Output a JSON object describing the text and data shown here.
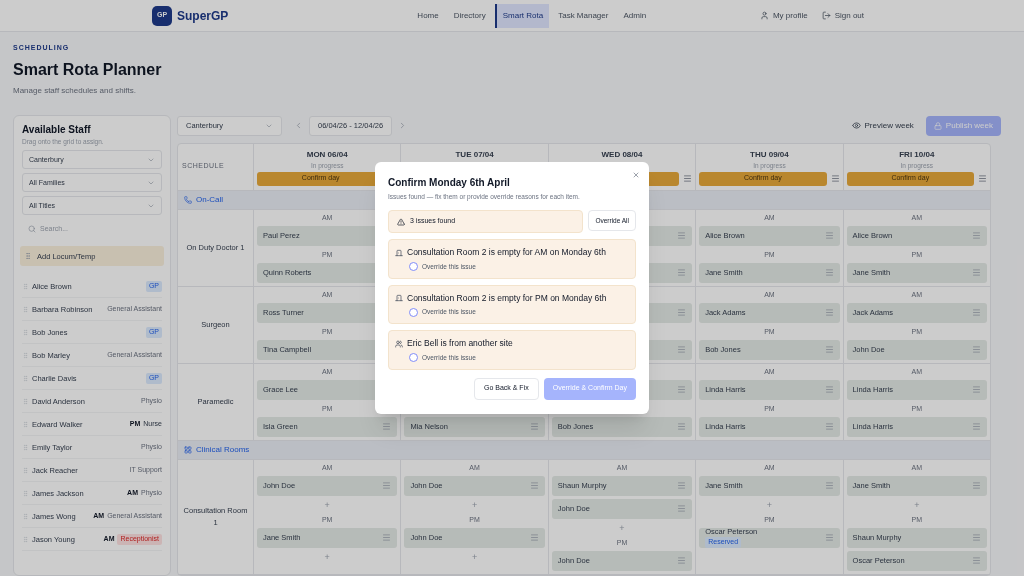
{
  "nav": {
    "logo": "GP",
    "brand": "SuperGP",
    "links": [
      {
        "label": "Home",
        "selected": false
      },
      {
        "label": "Directory",
        "selected": false
      },
      {
        "label": "Smart Rota",
        "selected": true
      },
      {
        "label": "Task Manager",
        "selected": false
      },
      {
        "label": "Admin",
        "selected": false
      }
    ],
    "profile": "My profile",
    "sign_out": "Sign out"
  },
  "header": {
    "eyebrow": "SCHEDULING",
    "title": "Smart Rota Planner",
    "subtitle": "Manage staff schedules and shifts."
  },
  "sidebar": {
    "title": "Available Staff",
    "hint": "Drag onto the grid to assign.",
    "filters": [
      "Canterbury",
      "All Families",
      "All Titles"
    ],
    "search": {
      "placeholder": "Search..."
    },
    "add_button": "Add Locum/Temp",
    "staff": [
      {
        "name": "Alice Brown",
        "tags": [
          {
            "text": "GP",
            "kind": "clinician"
          }
        ]
      },
      {
        "name": "Barbara Robinson",
        "tags": [
          {
            "text": "General Assistant",
            "kind": "role"
          }
        ]
      },
      {
        "name": "Bob Jones",
        "tags": [
          {
            "text": "GP",
            "kind": "clinician"
          }
        ]
      },
      {
        "name": "Bob Marley",
        "tags": [
          {
            "text": "General Assistant",
            "kind": "role"
          }
        ]
      },
      {
        "name": "Charlie Davis",
        "tags": [
          {
            "text": "GP",
            "kind": "clinician"
          }
        ]
      },
      {
        "name": "David Anderson",
        "tags": [
          {
            "text": "Physio",
            "kind": "role"
          }
        ]
      },
      {
        "name": "Edward Walker",
        "tags": [
          {
            "text": "PM",
            "kind": "shift"
          },
          {
            "text": "Nurse",
            "kind": "nurse"
          }
        ]
      },
      {
        "name": "Emily Taylor",
        "tags": [
          {
            "text": "Physio",
            "kind": "role"
          }
        ]
      },
      {
        "name": "Jack Reacher",
        "tags": [
          {
            "text": "IT Support",
            "kind": "role"
          }
        ]
      },
      {
        "name": "James Jackson",
        "tags": [
          {
            "text": "AM",
            "kind": "shift"
          },
          {
            "text": "Physio",
            "kind": "role"
          }
        ]
      },
      {
        "name": "James Wong",
        "tags": [
          {
            "text": "AM",
            "kind": "shift"
          },
          {
            "text": "General Assistant",
            "kind": "role"
          }
        ]
      },
      {
        "name": "Jason Young",
        "tags": [
          {
            "text": "AM",
            "kind": "shift"
          },
          {
            "text": "Receptionist",
            "kind": "alert"
          }
        ]
      }
    ]
  },
  "toolbar": {
    "location": "Canterbury",
    "date_range": "06/04/26 - 12/04/26",
    "preview": "Preview week",
    "publish": {
      "label": "Publish week",
      "disabled": true
    }
  },
  "schedule": {
    "corner": "SCHEDULE",
    "days": [
      {
        "label": "MON 06/04",
        "status": "In progress",
        "confirm": "Confirm day"
      },
      {
        "label": "TUE 07/04"
      },
      {
        "label": "WED 08/04"
      },
      {
        "label": "THU 09/04",
        "status": "In progress",
        "confirm": "Confirm day"
      },
      {
        "label": "FRI 10/04",
        "status": "In progress",
        "confirm": "Confirm day"
      }
    ],
    "sections": [
      {
        "title": "On-Call",
        "kind": "oncall",
        "rows": [
          {
            "name": "On Duty Doctor 1",
            "cells": {
              "mon": {
                "slots": [
                  {
                    "label": "AM",
                    "entries": [
                      {
                        "name": "Paul Perez"
                      }
                    ]
                  },
                  {
                    "label": "PM",
                    "entries": [
                      {
                        "name": "Quinn Roberts"
                      }
                    ]
                  }
                ]
              },
              "wed": {
                "slots": [
                  {
                    "entries": [
                      {
                        "menu": true
                      }
                    ]
                  },
                  {
                    "entries": [
                      {
                        "menu": true
                      }
                    ]
                  }
                ]
              },
              "thu": {
                "slots": [
                  {
                    "label": "AM",
                    "entries": [
                      {
                        "name": "Alice Brown"
                      }
                    ]
                  },
                  {
                    "label": "PM",
                    "entries": [
                      {
                        "name": "Jane Smith"
                      }
                    ]
                  }
                ]
              },
              "fri": {
                "slots": [
                  {
                    "label": "AM",
                    "entries": [
                      {
                        "name": "Alice Brown"
                      }
                    ]
                  },
                  {
                    "label": "PM",
                    "entries": [
                      {
                        "name": "Jane Smith"
                      }
                    ]
                  }
                ]
              }
            }
          },
          {
            "name": "Surgeon",
            "cells": {
              "mon": {
                "slots": [
                  {
                    "label": "AM",
                    "entries": [
                      {
                        "name": "Ross Turner"
                      }
                    ]
                  },
                  {
                    "label": "PM",
                    "entries": [
                      {
                        "name": "Tina Campbell"
                      }
                    ]
                  }
                ]
              },
              "wed": {
                "slots": [
                  {
                    "entries": [
                      {
                        "menu": true
                      }
                    ]
                  },
                  {
                    "entries": [
                      {
                        "menu": true
                      }
                    ]
                  }
                ]
              },
              "thu": {
                "slots": [
                  {
                    "label": "AM",
                    "entries": [
                      {
                        "name": "Jack Adams"
                      }
                    ]
                  },
                  {
                    "label": "PM",
                    "entries": [
                      {
                        "name": "Bob Jones"
                      }
                    ]
                  }
                ]
              },
              "fri": {
                "slots": [
                  {
                    "label": "AM",
                    "entries": [
                      {
                        "name": "Jack Adams"
                      }
                    ]
                  },
                  {
                    "label": "PM",
                    "entries": [
                      {
                        "name": "John Doe"
                      }
                    ]
                  }
                ]
              }
            }
          },
          {
            "name": "Paramedic",
            "cells": {
              "mon": {
                "slots": [
                  {
                    "label": "AM",
                    "entries": [
                      {
                        "name": "Grace Lee"
                      }
                    ]
                  },
                  {
                    "label": "PM",
                    "entries": [
                      {
                        "name": "Isla Green"
                      }
                    ]
                  }
                ]
              },
              "tue": {
                "slots": [
                  {
                    "entries": [
                      {
                        "name": "Mia Nelson"
                      }
                    ]
                  }
                ]
              },
              "wed": {
                "slots": [
                  {
                    "entries": [
                      {
                        "menu": true
                      }
                    ]
                  },
                  {
                    "entries": [
                      {
                        "name": "Bob Jones"
                      }
                    ]
                  }
                ]
              },
              "thu": {
                "slots": [
                  {
                    "label": "AM",
                    "entries": [
                      {
                        "name": "Linda Harris"
                      }
                    ]
                  },
                  {
                    "label": "PM",
                    "entries": [
                      {
                        "name": "Linda Harris"
                      }
                    ]
                  }
                ]
              },
              "fri": {
                "slots": [
                  {
                    "label": "AM",
                    "entries": [
                      {
                        "name": "Linda Harris"
                      }
                    ]
                  },
                  {
                    "label": "PM",
                    "entries": [
                      {
                        "name": "Linda Harris"
                      }
                    ]
                  }
                ]
              }
            }
          }
        ]
      },
      {
        "title": "Clinical Rooms",
        "kind": "rooms",
        "rows": [
          {
            "name": "Consultation Room 1",
            "cells": {
              "mon": {
                "slots": [
                  {
                    "label": "AM",
                    "entries": [
                      {
                        "name": "John Doe"
                      }
                    ],
                    "add": "+"
                  },
                  {
                    "label": "PM",
                    "entries": [
                      {
                        "name": "Jane Smith"
                      }
                    ],
                    "add": "+"
                  }
                ]
              },
              "tue": {
                "slots": [
                  {
                    "label": "AM",
                    "entries": [
                      {
                        "name": "John Doe"
                      }
                    ],
                    "add": "+"
                  },
                  {
                    "label": "PM",
                    "entries": [
                      {
                        "name": "John Doe"
                      }
                    ],
                    "add": "+"
                  }
                ]
              },
              "wed": {
                "slots": [
                  {
                    "label": "AM",
                    "entries": [
                      {
                        "name": "Shaun Murphy"
                      },
                      {
                        "name": "John Doe"
                      }
                    ],
                    "add": "+"
                  },
                  {
                    "label": "PM",
                    "entries": [
                      {
                        "name": "John Doe"
                      }
                    ]
                  }
                ]
              },
              "thu": {
                "slots": [
                  {
                    "label": "AM",
                    "entries": [
                      {
                        "name": "Jane Smith"
                      }
                    ],
                    "add": "+"
                  },
                  {
                    "label": "PM",
                    "entries": [
                      {
                        "name": "Oscar Peterson",
                        "badge": "Reserved"
                      }
                    ]
                  }
                ]
              },
              "fri": {
                "slots": [
                  {
                    "label": "AM",
                    "entries": [
                      {
                        "name": "Jane Smith"
                      }
                    ],
                    "add": "+"
                  },
                  {
                    "label": "PM",
                    "entries": [
                      {
                        "name": "Shaun Murphy"
                      },
                      {
                        "name": "Oscar Peterson"
                      }
                    ]
                  }
                ]
              }
            }
          }
        ]
      }
    ]
  },
  "dialog": {
    "title": "Confirm Monday 6th April",
    "subtitle": "Issues found — fix them or provide override reasons for each item.",
    "summary": "3 issues found",
    "override_all": "Override All",
    "issues": [
      {
        "kind": "room",
        "text": "Consultation Room 2 is empty for AM on Monday 6th",
        "option": "Override this issue",
        "checked": false
      },
      {
        "kind": "room",
        "text": "Consultation Room 2 is empty for PM on Monday 6th",
        "option": "Override this issue",
        "checked": false
      },
      {
        "kind": "staff",
        "text": "Eric Bell is from another site",
        "option": "Override this issue",
        "checked": false
      }
    ],
    "back": "Go Back & Fix",
    "confirm": {
      "label": "Override & Confirm Day",
      "disabled": true
    }
  }
}
